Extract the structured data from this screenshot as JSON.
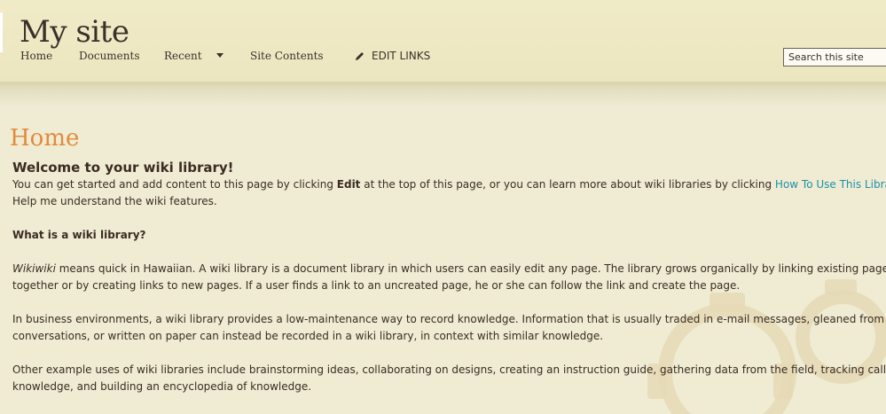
{
  "site": {
    "title": "My site"
  },
  "nav": {
    "home": "Home",
    "documents": "Documents",
    "recent": "Recent",
    "site_contents": "Site Contents",
    "edit_links": "EDIT LINKS"
  },
  "search": {
    "placeholder": "Search this site"
  },
  "page": {
    "title": "Home"
  },
  "content": {
    "heading": "Welcome to your wiki library!",
    "intro_prefix": "You can get started and add content to this page by clicking ",
    "intro_edit": "Edit",
    "intro_middle": " at the top of this page, or you can learn more about wiki libraries by clicking ",
    "intro_link": "How To Use This Library",
    "intro_suffix": ".",
    "help_line": "Help me understand the wiki features.",
    "subheading": "What is a wiki library?",
    "p1_term": "Wikiwiki",
    "p1_line1_rest": " means quick in Hawaiian. A wiki library is a document library in which users can easily edit any page. The library grows organically by linking existing pages",
    "p1_line2": "together or by creating links to new pages. If a user finds a link to an uncreated page, he or she can follow the link and create the page.",
    "p2_line1": "In business environments, a wiki library provides a low-maintenance way to record knowledge. Information that is usually traded in e-mail messages, gleaned from hallway",
    "p2_line2": "conversations, or written on paper can instead be recorded in a wiki library, in context with similar knowledge.",
    "p3_line1": "Other example uses of wiki libraries include brainstorming ideas, collaborating on designs, creating an instruction guide, gathering data from the field, tracking call center",
    "p3_line2": "knowledge, and building an encyclopedia of knowledge."
  },
  "colors": {
    "background": "#efecd3",
    "title_accent": "#e38a3d",
    "link": "#1f8fa8",
    "text": "#3b2b22"
  }
}
